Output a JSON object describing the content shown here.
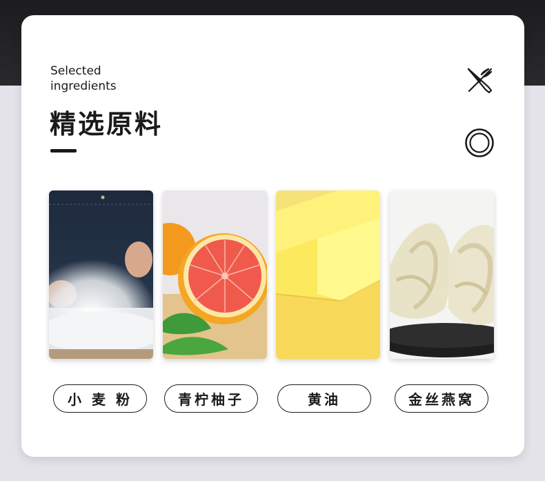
{
  "header": {
    "subtitle": "Selected\ningredients",
    "title": "精选原料"
  },
  "icons": {
    "utensils": "fork-knife-icon",
    "plate": "plate-icon"
  },
  "ingredients": [
    {
      "name": "小 麦 粉",
      "image": "flour-photo"
    },
    {
      "name": "青柠柚子",
      "image": "grapefruit-photo"
    },
    {
      "name": "黄油",
      "image": "butter-photo"
    },
    {
      "name": "金丝燕窝",
      "image": "birds-nest-photo"
    }
  ]
}
